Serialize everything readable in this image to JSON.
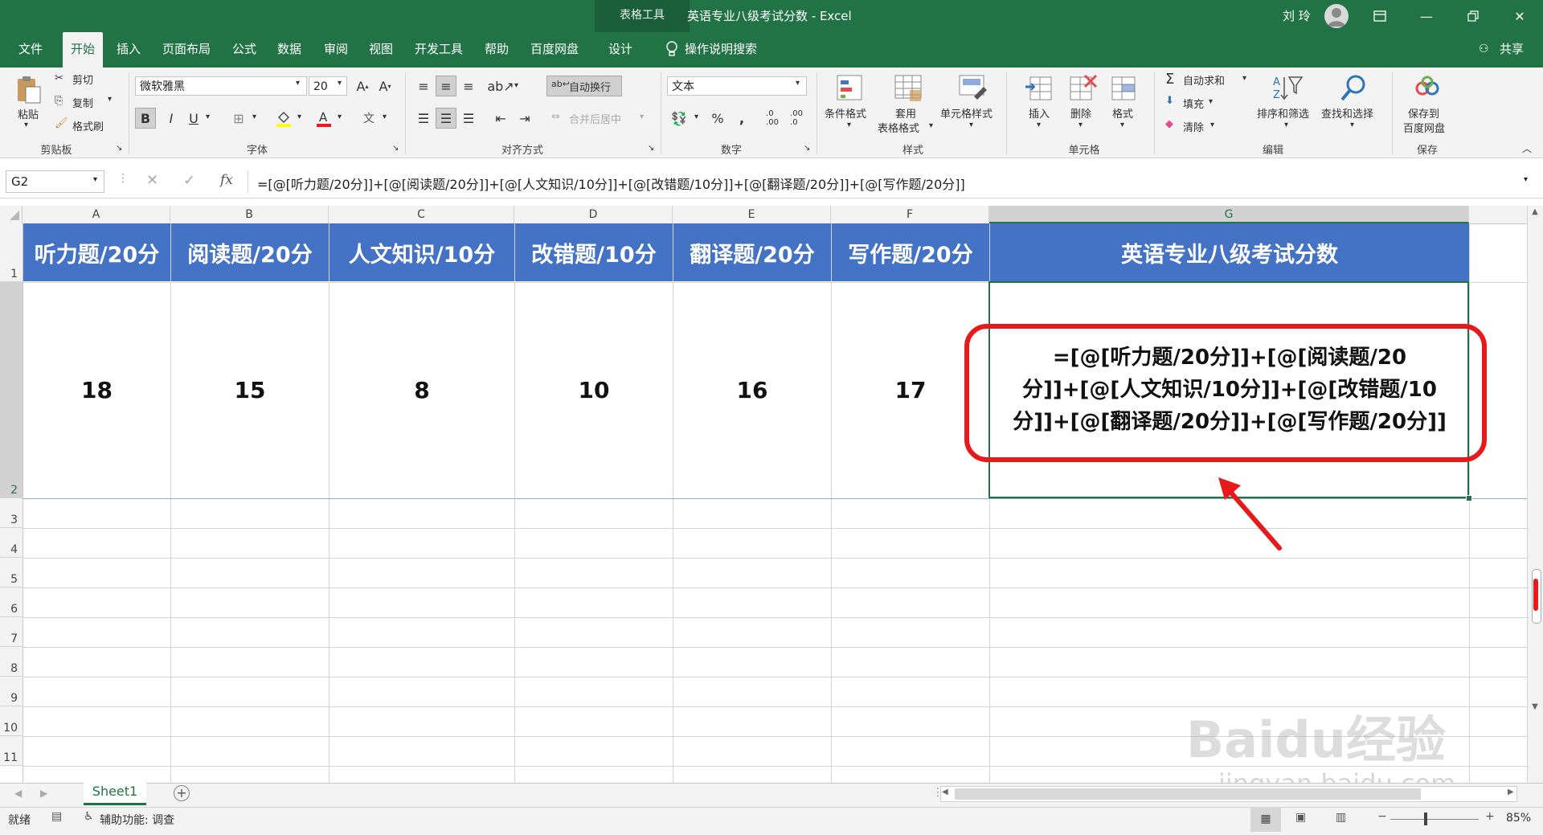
{
  "titlebar": {
    "context_label": "表格工具",
    "doc_title": "英语专业八级考试分数  -  Excel",
    "user_name": "刘 玲"
  },
  "tabs": [
    {
      "label": "文件"
    },
    {
      "label": "开始"
    },
    {
      "label": "插入"
    },
    {
      "label": "页面布局"
    },
    {
      "label": "公式"
    },
    {
      "label": "数据"
    },
    {
      "label": "审阅"
    },
    {
      "label": "视图"
    },
    {
      "label": "开发工具"
    },
    {
      "label": "帮助"
    },
    {
      "label": "百度网盘"
    },
    {
      "label": "设计"
    }
  ],
  "tell_me": "操作说明搜索",
  "share": "共享",
  "ribbon": {
    "clipboard": {
      "paste": "粘贴",
      "cut": "剪切",
      "copy": "复制",
      "format_painter": "格式刷",
      "title": "剪贴板"
    },
    "font": {
      "name": "微软雅黑",
      "size": "20",
      "title": "字体"
    },
    "alignment": {
      "wrap_text": "自动换行",
      "merge_center": "合并后居中",
      "title": "对齐方式"
    },
    "number": {
      "format": "文本",
      "title": "数字"
    },
    "styles": {
      "conditional": "条件格式",
      "table_fmt_1": "套用",
      "table_fmt_2": "表格格式",
      "cell_styles": "单元格样式",
      "title": "样式"
    },
    "cells": {
      "insert": "插入",
      "delete": "删除",
      "format": "格式",
      "title": "单元格"
    },
    "editing": {
      "autosum": "自动求和",
      "fill": "填充",
      "clear": "清除",
      "sort_filter": "排序和筛选",
      "find_select": "查找和选择",
      "title": "编辑"
    },
    "save": {
      "save_1": "保存到",
      "save_2": "百度网盘",
      "title": "保存"
    }
  },
  "formula_bar": {
    "name_box": "G2",
    "fx": "fx",
    "formula": "=[@[听力题/20分]]+[@[阅读题/20分]]+[@[人文知识/10分]]+[@[改错题/10分]]+[@[翻译题/20分]]+[@[写作题/20分]]"
  },
  "columns": [
    "A",
    "B",
    "C",
    "D",
    "E",
    "F",
    "G"
  ],
  "rows": [
    "1",
    "2",
    "3",
    "4",
    "5",
    "6",
    "7",
    "8",
    "9",
    "10",
    "11"
  ],
  "table": {
    "headers": [
      "听力题/20分",
      "阅读题/20分",
      "人文知识/10分",
      "改错题/10分",
      "翻译题/20分",
      "写作题/20分",
      "英语专业八级考试分数"
    ],
    "values": [
      "18",
      "15",
      "8",
      "10",
      "16",
      "17"
    ],
    "g2_lines": [
      "=[@[听力题/20分]]+[@[阅读题/20",
      "分]]+[@[人文知识/10分]]+[@[改错题/10",
      "分]]+[@[翻译题/20分]]+[@[写作题/20分]]"
    ]
  },
  "sheets": [
    "Sheet1"
  ],
  "status": {
    "ready": "就绪",
    "accessibility": "辅助功能: 调查",
    "zoom": "85%"
  },
  "watermark": {
    "line1": "Baidu经验",
    "line2": "jingyan.baidu.com"
  },
  "colors": {
    "excel_green": "#217346",
    "table_header": "#4472c4",
    "annotation_red": "#e8191a"
  }
}
